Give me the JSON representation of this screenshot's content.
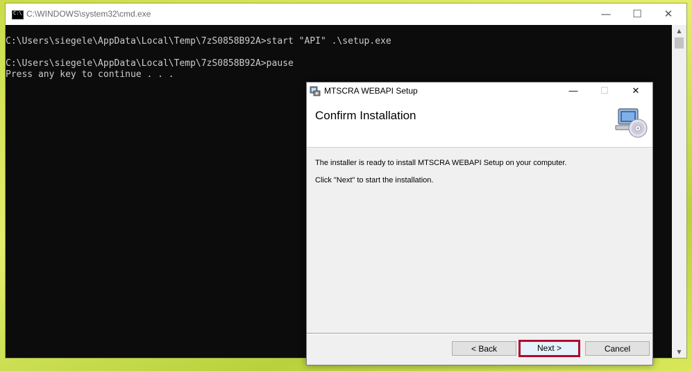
{
  "cmd": {
    "title": "C:\\WINDOWS\\system32\\cmd.exe",
    "controls": {
      "minimize": "—",
      "maximize": "☐",
      "close": "✕"
    },
    "lines": [
      "C:\\Users\\siegele\\AppData\\Local\\Temp\\7zS0858B92A>start \"API\" .\\setup.exe",
      "C:\\Users\\siegele\\AppData\\Local\\Temp\\7zS0858B92A>pause",
      "Press any key to continue . . ."
    ],
    "scroll": {
      "up": "▲",
      "down": "▼"
    }
  },
  "dialog": {
    "title": "MTSCRA WEBAPI Setup",
    "controls": {
      "minimize": "—",
      "maximize": "☐",
      "close": "✕"
    },
    "heading": "Confirm Installation",
    "text1": "The installer is ready to install MTSCRA WEBAPI Setup on your computer.",
    "text2": "Click \"Next\" to start the installation.",
    "buttons": {
      "back": "< Back",
      "next": "Next >",
      "cancel": "Cancel"
    },
    "colors": {
      "highlight": "#b00a2e",
      "focus": "#0078d7"
    }
  }
}
